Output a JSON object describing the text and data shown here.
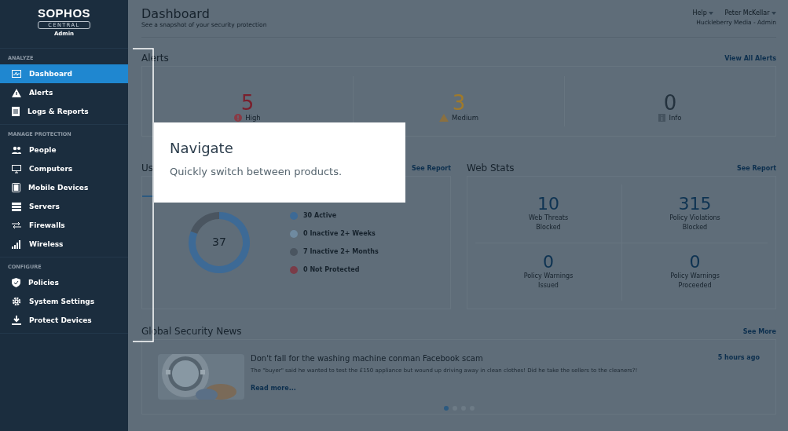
{
  "sidebar": {
    "logo": "SOPHOS",
    "product": "CENTRAL",
    "role": "Admin",
    "sections": [
      {
        "label": "ANALYZE",
        "items": [
          {
            "label": "Dashboard",
            "selected": true
          },
          {
            "label": "Alerts",
            "selected": false
          },
          {
            "label": "Logs & Reports",
            "selected": false
          }
        ]
      },
      {
        "label": "MANAGE PROTECTION",
        "items": [
          {
            "label": "People",
            "selected": false
          },
          {
            "label": "Computers",
            "selected": false
          },
          {
            "label": "Mobile Devices",
            "selected": false
          },
          {
            "label": "Servers",
            "selected": false
          },
          {
            "label": "Firewalls",
            "selected": false
          },
          {
            "label": "Wireless",
            "selected": false
          }
        ]
      },
      {
        "label": "CONFIGURE",
        "items": [
          {
            "label": "Policies",
            "selected": false
          },
          {
            "label": "System Settings",
            "selected": false
          },
          {
            "label": "Protect Devices",
            "selected": false
          }
        ]
      }
    ]
  },
  "header": {
    "title": "Dashboard",
    "subtitle": "See a snapshot of your security protection",
    "help": "Help",
    "user": "Peter McKellar",
    "org": "Huckleberry Media - Admin"
  },
  "alerts": {
    "title": "Alerts",
    "link": "View All Alerts",
    "counters": [
      {
        "count": "5",
        "label": "High",
        "kind": "high"
      },
      {
        "count": "3",
        "label": "Medium",
        "kind": "medium"
      },
      {
        "count": "0",
        "label": "Info",
        "kind": "info"
      }
    ]
  },
  "usage": {
    "title": "Us",
    "link": "See Report",
    "donut_total": "37",
    "legend": [
      {
        "count": "30",
        "label": "Active",
        "color": "#3d6a96"
      },
      {
        "count": "0",
        "label": "Inactive 2+ Weeks",
        "color": "#6f8aa0"
      },
      {
        "count": "7",
        "label": "Inactive 2+ Months",
        "color": "#4a5560"
      },
      {
        "count": "0",
        "label": "Not Protected",
        "color": "#7a3c48"
      }
    ]
  },
  "web_stats": {
    "title": "Web Stats",
    "link": "See Report",
    "stats": [
      {
        "count": "10",
        "label": "Web Threats Blocked"
      },
      {
        "count": "315",
        "label": "Policy Violations Blocked"
      },
      {
        "count": "0",
        "label": "Policy Warnings Issued"
      },
      {
        "count": "0",
        "label": "Policy Warnings Proceeded"
      }
    ]
  },
  "news": {
    "title": "Global Security News",
    "link": "See More",
    "headline": "Don't fall for the washing machine conman Facebook scam",
    "time": "5 hours ago",
    "excerpt": "The \"buyer\" said he wanted to test the £150 appliance but wound up driving away in clean clothes! Did he take the sellers to the cleaners?!",
    "read_more": "Read more...",
    "pages": [
      {
        "selected": true
      },
      {
        "selected": false
      },
      {
        "selected": false
      },
      {
        "selected": false
      }
    ]
  },
  "tooltip": {
    "title": "Navigate",
    "text": "Quickly switch between products."
  }
}
